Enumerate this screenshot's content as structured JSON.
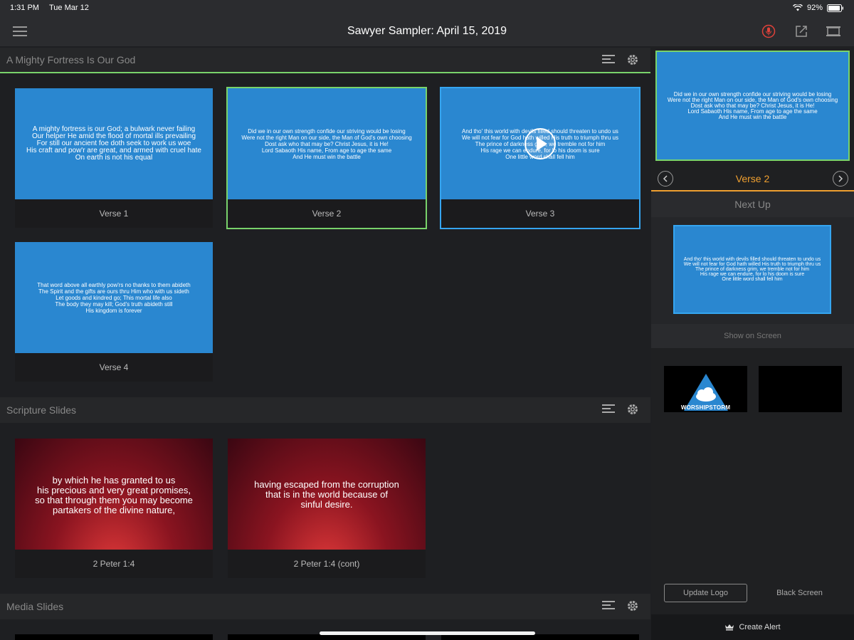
{
  "status": {
    "time": "1:31 PM",
    "date": "Tue Mar 12",
    "battery": "92%"
  },
  "nav": {
    "title": "Sawyer Sampler: April 15, 2019"
  },
  "sections": {
    "hymn": {
      "title": "A Mighty Fortress Is Our God",
      "slides": [
        {
          "label": "Verse 1",
          "text": "A mighty fortress is our God; a bulwark never failing\nOur helper He amid the flood of mortal ills prevailing\nFor still our ancient foe doth seek to work us woe\nHis craft and pow'r are great, and armed with cruel hate\nOn earth is not his equal"
        },
        {
          "label": "Verse 2",
          "text": "Did we in our own strength confide our striving would be losing\nWere not the right Man on our side, the Man of God's own choosing\nDost ask who that may be? Christ Jesus, it is He!\nLord Sabaoth His name, From age to age the same\nAnd He must win the battle"
        },
        {
          "label": "Verse 3",
          "text": "And tho' this world with devils filled should threaten to undo us\nWe will not fear for God hath willed His truth to triumph thru us\nThe prince of darkness grim, we tremble not for him\nHis rage we can endure, for lo his doom is sure\nOne little word shall fell him"
        },
        {
          "label": "Verse 4",
          "text": "That word above all earthly pow'rs no thanks to them abideth\nThe Spirit and the gifts are ours thru Him who with us sideth\nLet goods and kindred go; This mortal life also\nThe body they may kill; God's truth abideth still\nHis kingdom is forever"
        }
      ]
    },
    "scripture": {
      "title": "Scripture Slides",
      "slides": [
        {
          "label": "2 Peter 1:4",
          "text": "by which he has granted to us\nhis precious and very great promises,\nso that through them you may become\npartakers of the divine nature,"
        },
        {
          "label": "2 Peter 1:4 (cont)",
          "text": "having escaped from the corruption\nthat is in the world because of\nsinful desire."
        }
      ]
    },
    "media": {
      "title": "Media Slides"
    }
  },
  "right": {
    "preview_text": "Did we in our own strength confide our striving would be losing\nWere not the right Man on our side, the Man of God's own choosing\nDost ask who that may be? Christ Jesus, it is He!\nLord Sabaoth His name, From age to age the same\nAnd He must win the battle",
    "current_label": "Verse 2",
    "next_up": "Next Up",
    "next_text": "And tho' this world with devils filled should threaten to undo us\nWe will not fear for God hath willed His truth to triumph thru us\nThe prince of darkness grim, we tremble not for him\nHis rage we can endure, for lo his doom is sure\nOne little word shall fell him",
    "show_on_screen": "Show on Screen",
    "logo_text": "WORSHIPSTORM",
    "update_logo": "Update Logo",
    "black_screen": "Black Screen",
    "create_alert": "Create Alert"
  },
  "colors": {
    "slide_blue": "#2a87d0",
    "selected_green": "#79d36b",
    "live_blue": "#35a5f0",
    "accent_orange": "#f0a030",
    "mic_red": "#e0423a"
  }
}
